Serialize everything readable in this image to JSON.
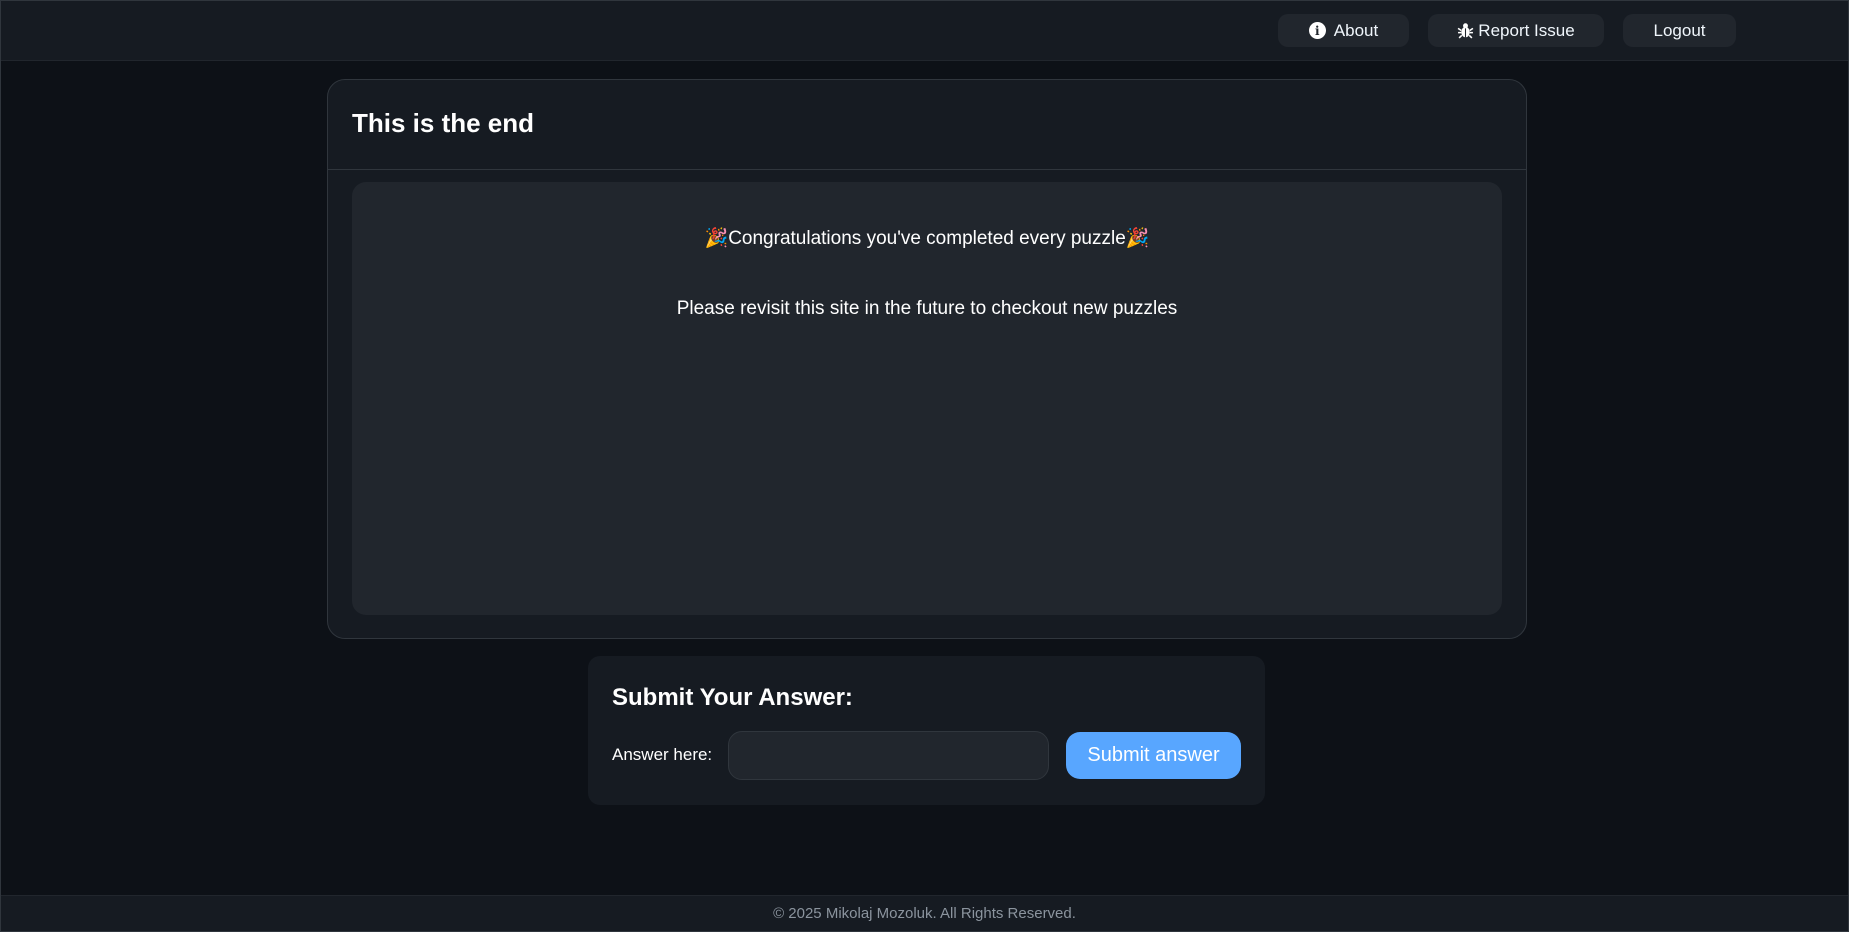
{
  "nav": {
    "about": "About",
    "report": "Report Issue",
    "logout": "Logout",
    "about_icon": "info-circle-icon",
    "report_icon": "bug-icon"
  },
  "puzzle": {
    "title": "This is the end",
    "message": "🎉Congratulations you've completed every puzzle🎉",
    "submessage": "Please revisit this site in the future to checkout new puzzles"
  },
  "answer": {
    "heading": "Submit Your Answer:",
    "label": "Answer here:",
    "value": "",
    "placeholder": "",
    "submit": "Submit answer"
  },
  "footer": {
    "text": "© 2025 Mikolaj Mozoluk. All Rights Reserved."
  },
  "colors": {
    "accent": "#58a6ff",
    "background": "#0d1117",
    "surface": "#161b22"
  }
}
